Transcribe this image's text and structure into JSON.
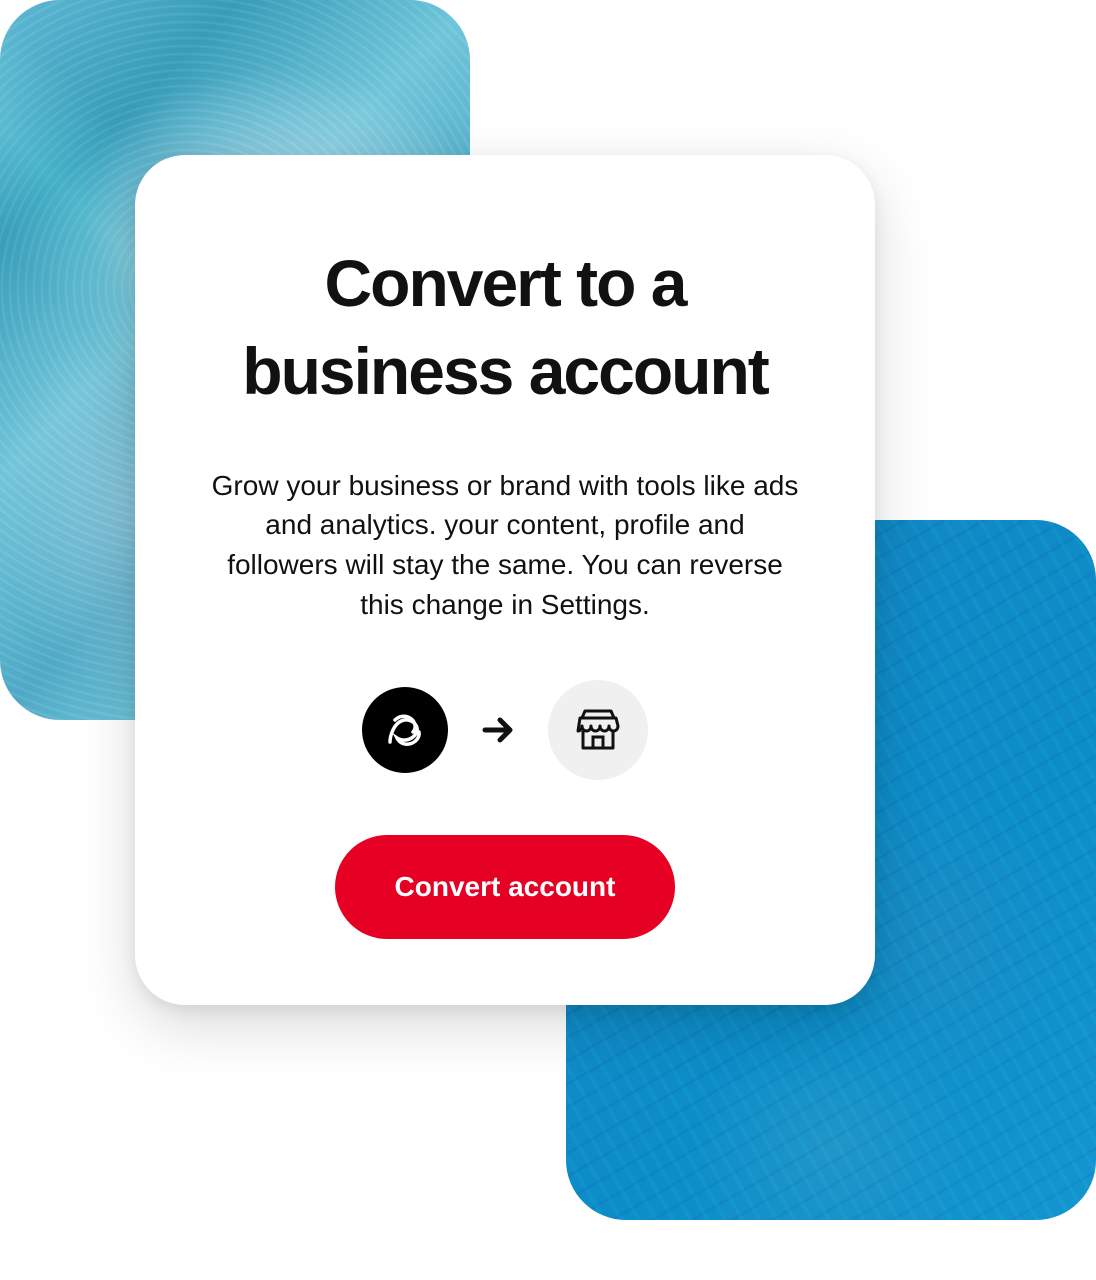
{
  "card": {
    "title": "Convert to a business account",
    "description": "Grow your business or brand with tools like ads and analytics. your content, profile and followers will stay the same. You can reverse this change in Settings.",
    "button_label": "Convert account"
  },
  "icons": {
    "avatar": "user-avatar-icon",
    "arrow": "arrow-right-icon",
    "storefront": "storefront-icon"
  },
  "colors": {
    "primary": "#e60023",
    "text": "#111111",
    "bg_gray": "#f0f0f0"
  }
}
